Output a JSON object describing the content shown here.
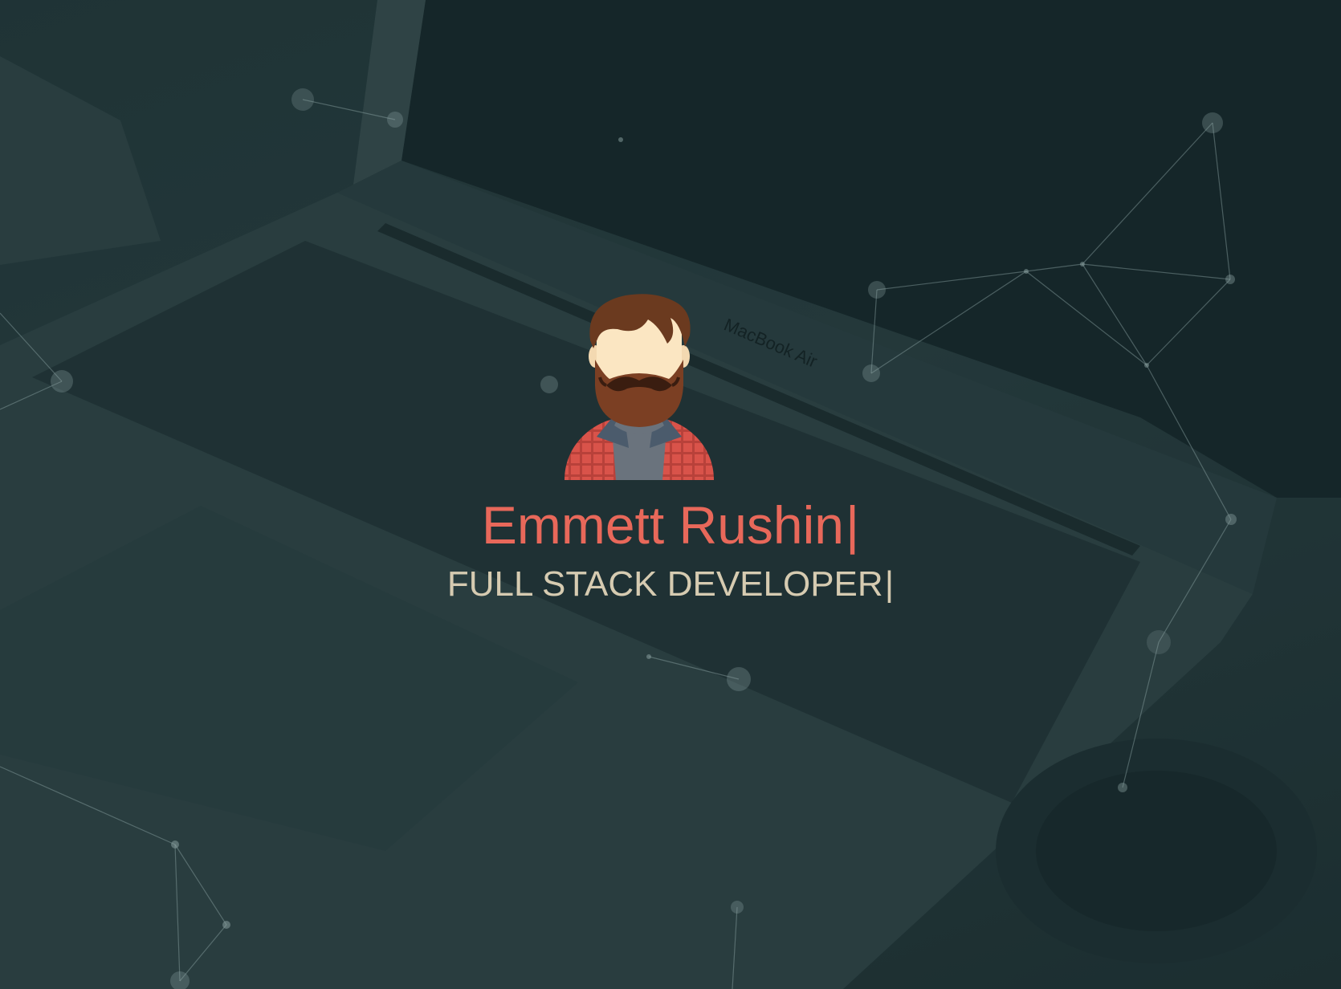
{
  "hero": {
    "name": "Emmett Rushin",
    "name_cursor": "|",
    "title": "FULL STACK DEVELOPER",
    "title_cursor": "|"
  },
  "background": {
    "laptop_label": "MacBook Air"
  },
  "colors": {
    "name": "#e8685a",
    "title": "#d6cbb1",
    "overlay": "#16282a",
    "particles": "#8fa6a6"
  },
  "icons": {
    "avatar": "bearded-developer-avatar-icon"
  }
}
